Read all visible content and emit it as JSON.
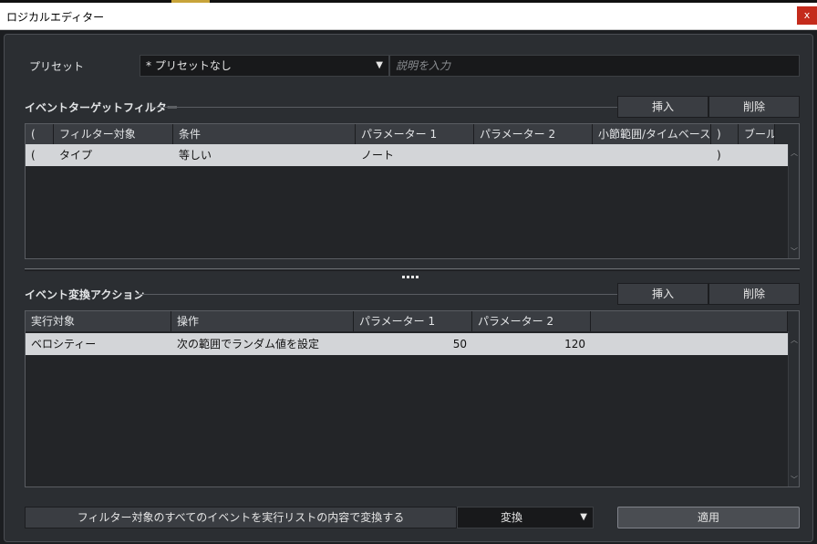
{
  "window": {
    "title": "ロジカルエディター",
    "close_label": "x"
  },
  "preset": {
    "label": "プリセット",
    "value": "* プリセットなし",
    "description_placeholder": "説明を入力"
  },
  "filter": {
    "title": "イベントターゲットフィルター",
    "insert_label": "挿入",
    "delete_label": "削除",
    "columns": [
      "(",
      "フィルター対象",
      "条件",
      "パラメーター 1",
      "パラメーター 2",
      "小節範囲/タイムベース",
      ")",
      "ブール"
    ],
    "rows": [
      {
        "open": "(",
        "target": "タイプ",
        "condition": "等しい",
        "param1": "ノート",
        "param2": "",
        "range": "",
        "close": ")",
        "bool": ""
      }
    ]
  },
  "action": {
    "title": "イベント変換アクション",
    "insert_label": "挿入",
    "delete_label": "削除",
    "columns": [
      "実行対象",
      "操作",
      "パラメーター 1",
      "パラメーター 2",
      ""
    ],
    "rows": [
      {
        "target": "ベロシティー",
        "operation": "次の範囲でランダム値を設定",
        "param1": "50",
        "param2": "120",
        "extra": ""
      }
    ]
  },
  "footer": {
    "apply_description": "フィルター対象のすべてのイベントを実行リストの内容で変換する",
    "mode_value": "変換",
    "apply_label": "適用"
  },
  "icons": {
    "dropdown": "chevron-down-icon",
    "scroll_up": "chevron-up-icon",
    "scroll_down": "chevron-down-icon"
  }
}
